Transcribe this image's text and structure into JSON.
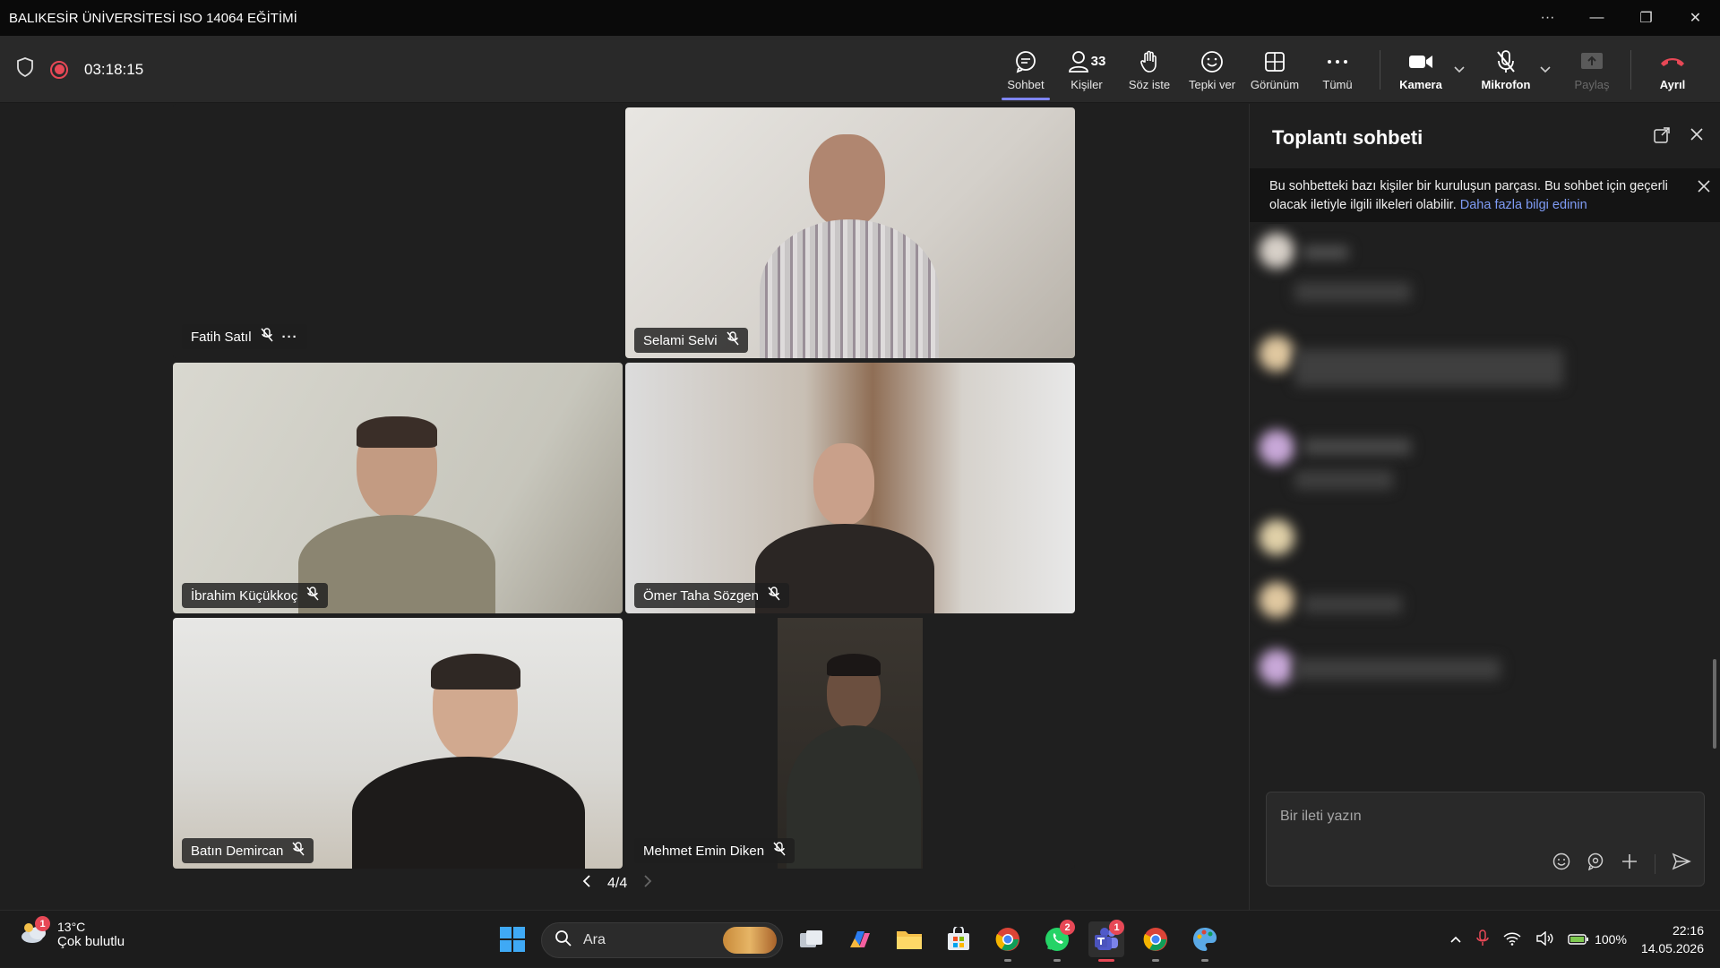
{
  "window": {
    "title": "BALIKESİR ÜNİVERSİTESİ ISO 14064 EĞİTİMİ",
    "controls": [
      "···",
      "—",
      "❐",
      "✕"
    ]
  },
  "meeting": {
    "timer": "03:18:15"
  },
  "toolbar": {
    "chat": "Sohbet",
    "people": "Kişiler",
    "people_count": "33",
    "raise_hand": "Söz iste",
    "react": "Tepki ver",
    "view": "Görünüm",
    "more": "Tümü",
    "camera": "Kamera",
    "mic": "Mikrofon",
    "share": "Paylaş",
    "leave": "Ayrıl"
  },
  "participants": [
    {
      "name": "Fatih Satıl"
    },
    {
      "name": "Selami Selvi"
    },
    {
      "name": "İbrahim Küçükkoç"
    },
    {
      "name": "Ömer Taha Sözgen"
    },
    {
      "name": "Batın Demircan"
    },
    {
      "name": "Mehmet Emin Diken"
    }
  ],
  "pager": {
    "label": "4/4"
  },
  "chat": {
    "title": "Toplantı sohbeti",
    "notice": "Bu sohbetteki bazı kişiler bir kuruluşun parçası. Bu sohbet için geçerli olacak iletiyle ilgili ilkeleri olabilir.",
    "notice_link": "Daha fazla bilgi edinin",
    "compose_placeholder": "Bir ileti yazın"
  },
  "taskbar": {
    "weather_temp": "13°C",
    "weather_desc": "Çok bulutlu",
    "weather_badge": "1",
    "search": "Ara",
    "whatsapp_badge": "2",
    "teams_badge": "1",
    "battery": "100%",
    "time": "22:16",
    "date": "14.05.2026"
  },
  "colors": {
    "accent": "#7f85f5",
    "record": "#e74856",
    "leave": "#e74856"
  }
}
